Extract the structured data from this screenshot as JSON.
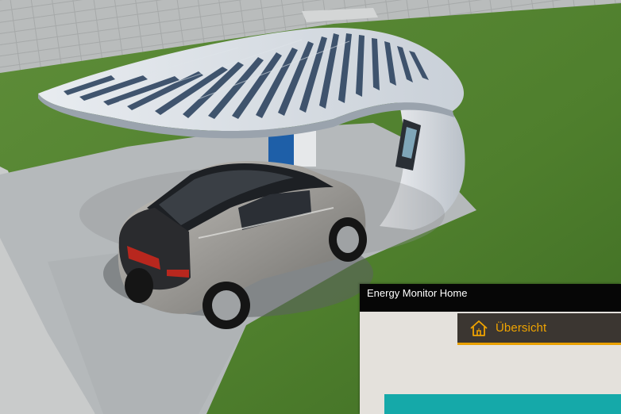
{
  "window": {
    "title": "Energy Monitor Home"
  },
  "nav": {
    "active_tab": {
      "label": "Übersicht",
      "icon": "home-icon"
    }
  },
  "colors": {
    "accent": "#e9a000",
    "titlebar": "#060606",
    "tab_background": "#3b3631",
    "content_background": "#e4e1dc",
    "panel": "#15a9a9"
  }
}
